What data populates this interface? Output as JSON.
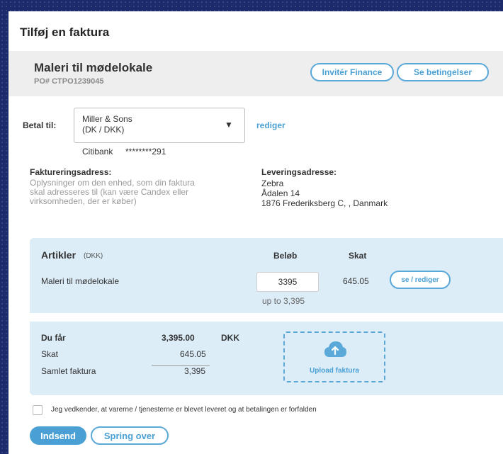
{
  "dialog": {
    "title": "Tilføj en faktura"
  },
  "order": {
    "title": "Maleri til mødelokale",
    "po": "PO# CTPO1239045",
    "invite_label": "Invitér Finance",
    "terms_label": "Se betingelser"
  },
  "pay_to": {
    "label": "Betal til:",
    "selected_line1": "Miller & Sons",
    "selected_line2": "(DK / DKK)",
    "edit_label": "rediger",
    "bank_name": "Citibank",
    "account_masked": "********291"
  },
  "billing": {
    "heading": "Faktureringsadress:",
    "description": "Oplysninger om den enhed, som din faktura skal adresseres til (kan være Candex eller virksomheden, der er køber)"
  },
  "delivery": {
    "heading": "Leveringsadresse:",
    "line1": "Zebra",
    "line2": "Ådalen 14",
    "line3": "1876 Frederiksberg C, , Danmark"
  },
  "articles": {
    "heading": "Artikler",
    "currency_note": "(DKK)",
    "col_amount": "Beløb",
    "col_tax": "Skat",
    "items": [
      {
        "name": "Maleri til mødelokale",
        "amount": "3395",
        "limit": "up to 3,395",
        "tax": "645.05",
        "action": "se / rediger"
      }
    ]
  },
  "summary": {
    "you_get_label": "Du får",
    "you_get_value": "3,395.00",
    "currency": "DKK",
    "tax_label": "Skat",
    "tax_value": "645.05",
    "total_label": "Samlet faktura",
    "total_value": "3,395",
    "upload_label": "Upload faktura"
  },
  "acknowledge": {
    "text": "Jeg vedkender, at varerne / tjenesterne er blevet leveret og at betalingen er forfalden",
    "checked": false
  },
  "actions": {
    "submit_label": "Indsend",
    "skip_label": "Spring over"
  },
  "colors": {
    "accent": "#4aa0d4",
    "panel": "#dcedf8",
    "backdrop": "#1b2a6b"
  }
}
